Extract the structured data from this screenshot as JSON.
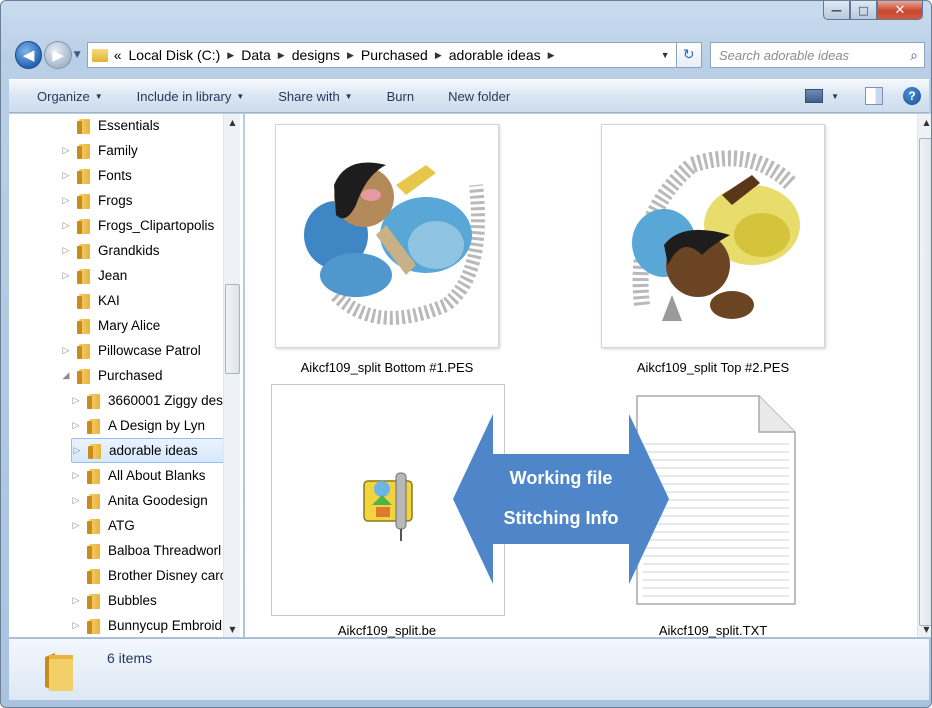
{
  "window": {
    "buttons": {
      "minimize": "—",
      "maximize": "□",
      "close": "✕"
    }
  },
  "address_bar": {
    "overflow": "«",
    "crumbs": [
      "Local Disk (C:)",
      "Data",
      "designs",
      "Purchased",
      "adorable ideas"
    ],
    "search_placeholder": "Search adorable ideas"
  },
  "toolbar": {
    "organize": "Organize",
    "include_in_library": "Include in library",
    "share_with": "Share with",
    "burn": "Burn",
    "new_folder": "New folder"
  },
  "nav_tree": {
    "items": [
      {
        "label": "Essentials",
        "arrow": ""
      },
      {
        "label": "Family",
        "arrow": "▷"
      },
      {
        "label": "Fonts",
        "arrow": "▷"
      },
      {
        "label": "Frogs",
        "arrow": "▷"
      },
      {
        "label": "Frogs_Clipartopolis",
        "arrow": "▷"
      },
      {
        "label": "Grandkids",
        "arrow": "▷"
      },
      {
        "label": "Jean",
        "arrow": "▷"
      },
      {
        "label": "KAI",
        "arrow": ""
      },
      {
        "label": "Mary Alice",
        "arrow": ""
      },
      {
        "label": "Pillowcase Patrol",
        "arrow": "▷"
      },
      {
        "label": "Purchased",
        "arrow": "◢"
      },
      {
        "label": "3660001 Ziggy des",
        "arrow": "▷"
      },
      {
        "label": "A Design by Lyn",
        "arrow": "▷"
      },
      {
        "label": "adorable ideas",
        "arrow": "▷"
      },
      {
        "label": "All About Blanks",
        "arrow": "▷"
      },
      {
        "label": "Anita Goodesign",
        "arrow": "▷"
      },
      {
        "label": "ATG",
        "arrow": "▷"
      },
      {
        "label": "Balboa Threadworl",
        "arrow": ""
      },
      {
        "label": "Brother Disney carc",
        "arrow": ""
      },
      {
        "label": "Bubbles",
        "arrow": "▷"
      },
      {
        "label": "Bunnycup Embroid",
        "arrow": "▷"
      }
    ],
    "selected": "adorable ideas"
  },
  "files": [
    {
      "name": "Aikcf109_split Bottom #1.PES",
      "kind": "embroidery-preview"
    },
    {
      "name": "Aikcf109_split Top #2.PES",
      "kind": "embroidery-preview"
    },
    {
      "name": "Aikcf109_split.be",
      "kind": "app-file"
    },
    {
      "name": "Aikcf109_split.TXT",
      "kind": "text-document"
    }
  ],
  "annotation": {
    "line1": "Working file",
    "line2": "Stitching Info",
    "color": "#4e86c9"
  },
  "details": {
    "item_count": "6 items"
  },
  "colors": {
    "selection_bg": "#d6e8fc",
    "selection_border": "#93c0f0",
    "toolbar_text": "#1e395b",
    "folder": "#e8b43c"
  }
}
